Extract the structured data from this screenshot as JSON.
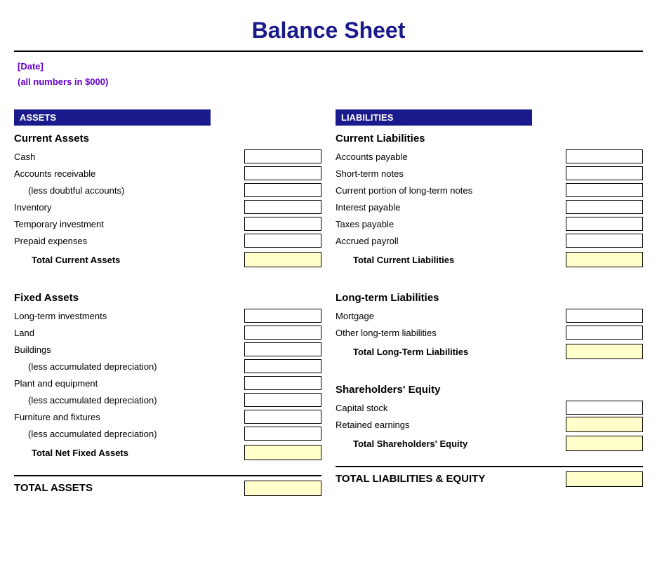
{
  "title": "Balance Sheet",
  "subtitle_date": "[Date]",
  "subtitle_numbers": "(all numbers in $000)",
  "assets": {
    "header": "ASSETS",
    "current_assets": {
      "title": "Current Assets",
      "items": [
        {
          "label": "Cash",
          "indented": false
        },
        {
          "label": "Accounts receivable",
          "indented": false
        },
        {
          "label": "(less doubtful accounts)",
          "indented": true
        },
        {
          "label": "Inventory",
          "indented": false
        },
        {
          "label": "Temporary investment",
          "indented": false
        },
        {
          "label": "Prepaid expenses",
          "indented": false
        }
      ],
      "total_label": "Total Current Assets"
    },
    "fixed_assets": {
      "title": "Fixed Assets",
      "items": [
        {
          "label": "Long-term investments",
          "indented": false
        },
        {
          "label": "Land",
          "indented": false
        },
        {
          "label": "Buildings",
          "indented": false
        },
        {
          "label": "(less accumulated depreciation)",
          "indented": true
        },
        {
          "label": "Plant and equipment",
          "indented": false
        },
        {
          "label": "(less accumulated depreciation)",
          "indented": true
        },
        {
          "label": "Furniture and fixtures",
          "indented": false
        },
        {
          "label": "(less accumulated depreciation)",
          "indented": true
        }
      ],
      "total_label": "Total Net Fixed Assets"
    },
    "grand_total_label": "TOTAL ASSETS"
  },
  "liabilities": {
    "header": "LIABILITIES",
    "current_liabilities": {
      "title": "Current Liabilities",
      "items": [
        {
          "label": "Accounts payable",
          "indented": false
        },
        {
          "label": "Short-term notes",
          "indented": false
        },
        {
          "label": "Current portion of long-term notes",
          "indented": false
        },
        {
          "label": "Interest payable",
          "indented": false
        },
        {
          "label": "Taxes payable",
          "indented": false
        },
        {
          "label": "Accrued payroll",
          "indented": false
        }
      ],
      "total_label": "Total Current Liabilities"
    },
    "longterm_liabilities": {
      "title": "Long-term Liabilities",
      "items": [
        {
          "label": "Mortgage",
          "indented": false
        },
        {
          "label": "Other long-term liabilities",
          "indented": false
        }
      ],
      "total_label": "Total Long-Term Liabilities"
    },
    "equity": {
      "title": "Shareholders' Equity",
      "items": [
        {
          "label": "Capital stock",
          "indented": false
        },
        {
          "label": "Retained earnings",
          "indented": false
        }
      ],
      "total_label": "Total Shareholders' Equity"
    },
    "grand_total_label": "TOTAL LIABILITIES & EQUITY"
  }
}
